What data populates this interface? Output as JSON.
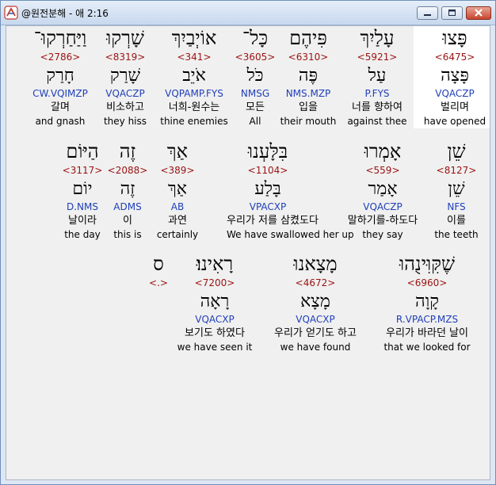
{
  "window": {
    "title": "@원전분해 - 애 2:16"
  },
  "rows": [
    [
      {
        "heb": "פָּצוּ",
        "num": "<6475>",
        "lex": "פָּצָה",
        "morph": "VQACZP",
        "ko": "벌리며",
        "en": "have opened",
        "hl": true
      },
      {
        "heb": "עָלַיִךְ",
        "num": "<5921>",
        "lex": "עַל",
        "morph": "P.FYS",
        "ko": "너를 향하여",
        "en": "against thee"
      },
      {
        "heb": "פִּיהֶם",
        "num": "<6310>",
        "lex": "פֶּה",
        "morph": "NMS.MZP",
        "ko": "입을",
        "en": "their mouth"
      },
      {
        "heb": "כָּל־",
        "num": "<3605>",
        "lex": "כֹּל",
        "morph": "NMSG",
        "ko": "모든",
        "en": "All"
      },
      {
        "heb": "אוֹיְבַיִךְ",
        "num": "<341>",
        "lex": "אֹיֵב",
        "morph": "VQPAMP.FYS",
        "ko": "너희-원수는",
        "en": "thine enemies"
      },
      {
        "heb": "שָׁרְקוּ",
        "num": "<8319>",
        "lex": "שָׁרַק",
        "morph": "VQACZP",
        "ko": "비소하고",
        "en": "they hiss"
      },
      {
        "heb": "וַיַּחַרְקוּ־",
        "num": "<2786>",
        "lex": "חָרַק",
        "morph": "CW.VQIMZP",
        "ko": "갈며",
        "en": "and gnash"
      }
    ],
    [
      {
        "heb": "שֵׁן",
        "num": "<8127>",
        "lex": "שֵׁן",
        "morph": "NFS",
        "ko": "이를",
        "en": "the teeth"
      },
      {
        "heb": "אָמְרוּ",
        "num": "<559>",
        "lex": "אָמַר",
        "morph": "VQACZP",
        "ko": "말하기를-하도다",
        "en": "they say"
      },
      {
        "heb": "בִּלָּעְנוּ",
        "num": "<1104>",
        "lex": "בָּלַע",
        "morph": "VPACXP",
        "ko": "우리가 저를 삼켰도다",
        "en": "We have swallowed her up"
      },
      {
        "heb": "אַךְ",
        "num": "<389>",
        "lex": "אַךְ",
        "morph": "AB",
        "ko": "과연",
        "en": "certainly"
      },
      {
        "heb": "זֶה",
        "num": "<2088>",
        "lex": "זֶה",
        "morph": "ADMS",
        "ko": "이",
        "en": "this is"
      },
      {
        "heb": "הַיּוֹם",
        "num": "<3117>",
        "lex": "יוֹם",
        "morph": "D.NMS",
        "ko": "날이라",
        "en": "the day"
      }
    ],
    [
      {
        "heb": "שֶׁקִּוִּינֻהוּ",
        "num": "<6960>",
        "lex": "קָוָה",
        "morph": "R.VPACP.MZS",
        "ko": "우리가 바라던 날이",
        "en": "that we looked for"
      },
      {
        "heb": "מָצָאנוּ",
        "num": "<4672>",
        "lex": "מָצָא",
        "morph": "VQACXP",
        "ko": "우리가 얻기도 하고",
        "en": "we have found"
      },
      {
        "heb": "רָאִינוּ׃",
        "num": "<7200>",
        "lex": "רָאָה",
        "morph": "VQACXP",
        "ko": "보기도 하였다",
        "en": "we have seen it"
      },
      {
        "heb": "ס",
        "num": "<.>",
        "lex": "",
        "morph": "",
        "ko": "",
        "en": ""
      }
    ]
  ]
}
